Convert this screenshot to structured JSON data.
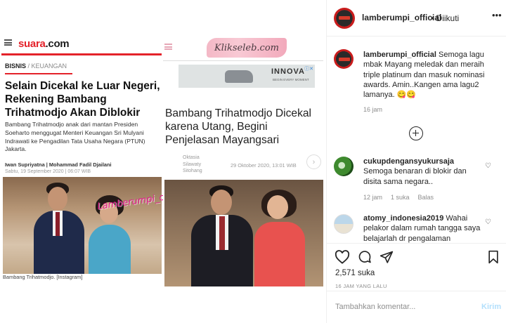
{
  "post": {
    "account": "lamberumpi_official",
    "follow_state": "• Diikuti",
    "caption_user": "lamberumpi_official",
    "caption_text": "Semoga lagu mbak Mayang meledak dan meraih triple platinum dan masuk nominasi awards. Amin..Kangen ama lagu2 lamanya. 😋😋",
    "caption_time": "16 jam",
    "likes": "2,571 suka",
    "posted_ago": "16 JAM YANG LALU",
    "add_comment_placeholder": "Tambahkan komentar...",
    "post_button": "Kirim"
  },
  "comments": [
    {
      "user": "cukupdengansyukursaja",
      "text": "Semoga benaran di blokir dan disita sama negara..",
      "time": "12 jam",
      "likes": "1 suka",
      "reply": "Balas"
    },
    {
      "user": "atomy_indonesia2019",
      "text": "Wahai pelakor dalam rumah tangga saya belajarlah dr pengalaman",
      "time": "",
      "likes": "",
      "reply": ""
    }
  ],
  "image": {
    "suara": {
      "logo_main": "suara",
      "logo_dot": ".com",
      "category": "BISNIS",
      "category_sep": " / ",
      "subcategory": "KEUANGAN",
      "title": "Selain Dicekal ke Luar Negeri, Rekening Bambang Trihatmodjo Akan Diblokir",
      "body": "Bambang Trihatmodjo anak dari mantan Presiden Soeharto menggugat Menteri Keuangan Sri Mulyani Indrawati ke Pengadilan Tata Usaha Negara (PTUN) Jakarta.",
      "authors": "Iwan Supriyatna | Mohammad Fadil Djailani",
      "date": "Sabtu, 19 September 2020 | 06:07 WIB",
      "caption": "Bambang Trihatmodjo. [Instagram]"
    },
    "watermark": "Lamberumpi_official",
    "klikseleb": {
      "logo": "Klikseleb.com",
      "ad_brand": "INNOVA",
      "ad_sub": "BEGIN EVERY MOMENT",
      "ad_badge": "ⓘ✕",
      "title": "Bambang Trihatmodjo Dicekal karena Utang, Begini Penjelasan Mayangsari",
      "author": "Oktasia Silawaty Sitohang",
      "date": "29 Oktober 2020, 13:01 WIB",
      "next": "›"
    }
  },
  "colors": {
    "suara_red": "#e4222a",
    "instagram_link": "#b2dffc",
    "watermark_pink": "#e21b8c"
  },
  "icons": [
    "hamburger-icon",
    "heart-icon",
    "comment-icon",
    "share-icon",
    "bookmark-icon",
    "more-options-icon",
    "load-more-icon"
  ]
}
